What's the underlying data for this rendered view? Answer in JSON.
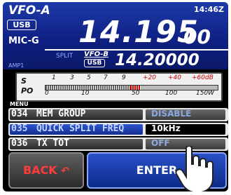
{
  "vfo_a": {
    "label": "VFO-A",
    "mode": "USB",
    "mic_gain_label": "MIC-G",
    "amp_label": "AMP1"
  },
  "clock": "14:46Z",
  "main_freq": {
    "major": "14.195",
    "minor": "00"
  },
  "split_label": "SPLIT",
  "vfo_b": {
    "label": "VFO-B",
    "mode": "USB",
    "freq": "14.20000"
  },
  "meter": {
    "s_label": "S",
    "po_label": "PO",
    "s_ticks": [
      "1",
      "3",
      "5",
      "7",
      "9"
    ],
    "s_over_ticks": [
      "+20",
      "+40",
      "+60dB"
    ],
    "po_ticks": [
      "0",
      "10",
      "50",
      "100",
      "150W"
    ],
    "level_fraction": 0.49,
    "red_fraction": 0.06
  },
  "menu": {
    "label": "MENU",
    "rows": [
      {
        "number": "034",
        "name": "MEM GROUP",
        "value": "DISABLE",
        "selected": false
      },
      {
        "number": "035",
        "name": "QUICK SPLIT FREQ",
        "value": "10kHz",
        "selected": true
      },
      {
        "number": "036",
        "name": "TX TOT",
        "value": "OFF",
        "selected": false
      }
    ]
  },
  "buttons": {
    "back": "BACK",
    "enter": "ENTER"
  },
  "colors": {
    "accent_blue": "#1d3aa8",
    "selected_value": "#ffffff",
    "back_text": "#ff3c3c"
  }
}
